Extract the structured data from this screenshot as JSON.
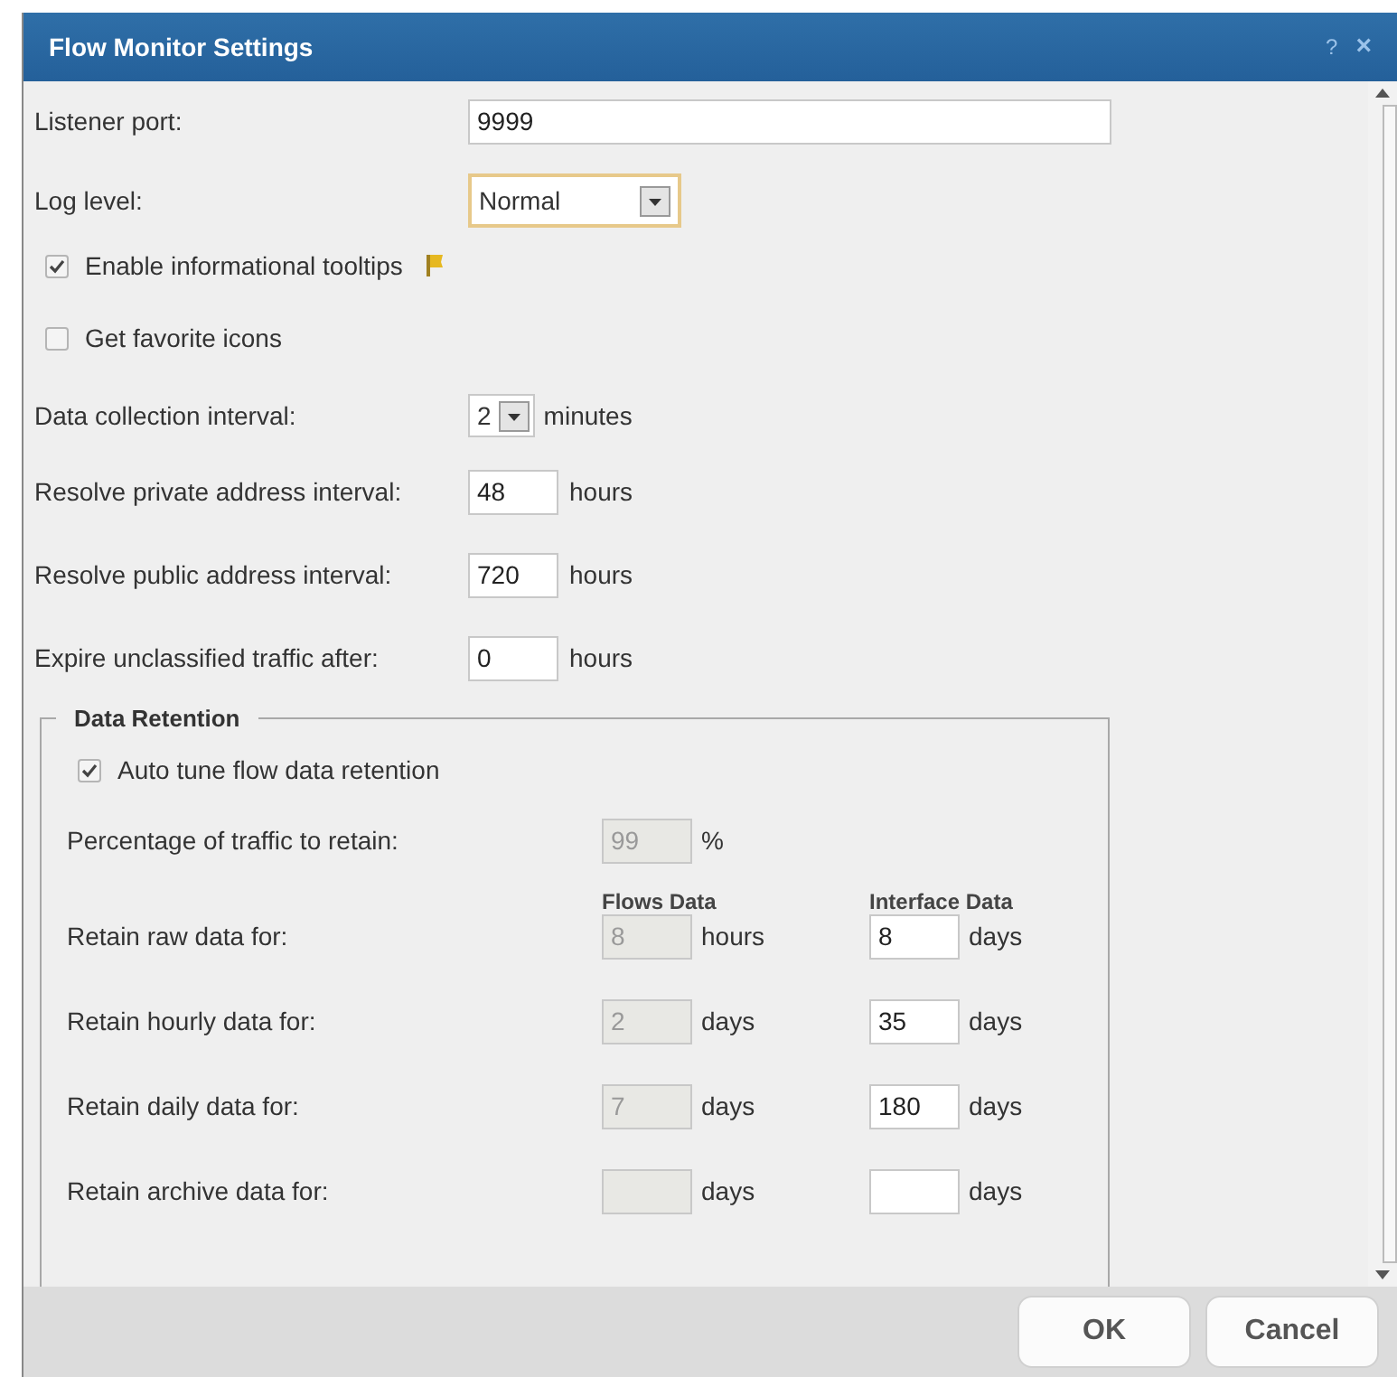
{
  "window": {
    "title": "Flow Monitor Settings",
    "help": "?",
    "close": "×"
  },
  "settings": [
    {
      "kind": "text",
      "label": "Listener port:",
      "value": "9999"
    },
    {
      "kind": "select",
      "label": "Log level:",
      "value": "Normal",
      "focused": true
    },
    {
      "kind": "checkbox",
      "label": "Enable informational tooltips",
      "checked": true,
      "flag": true
    },
    {
      "kind": "checkbox",
      "label": "Get favorite icons",
      "checked": false,
      "flag": false
    },
    {
      "kind": "small-select",
      "label": "Data collection interval:",
      "value": "2",
      "unit": "minutes"
    },
    {
      "kind": "number",
      "label": "Resolve private address interval:",
      "value": "48",
      "unit": "hours"
    },
    {
      "kind": "number",
      "label": "Resolve public address interval:",
      "value": "720",
      "unit": "hours"
    },
    {
      "kind": "number",
      "label": "Expire unclassified traffic after:",
      "value": "0",
      "unit": "hours"
    }
  ],
  "retention": {
    "title": "Data Retention",
    "auto_tune": {
      "label": "Auto tune flow data retention",
      "checked": true
    },
    "percentage": {
      "label": "Percentage of traffic to retain:",
      "value": "99",
      "unit": "%",
      "disabled": true
    },
    "columns": [
      "Flows Data",
      "Interface Data"
    ],
    "rows": [
      {
        "label": "Retain raw data for:",
        "flows": "8",
        "flows_unit": "hours",
        "flows_disabled": true,
        "iface": "8",
        "iface_unit": "days"
      },
      {
        "label": "Retain hourly data for:",
        "flows": "2",
        "flows_unit": "days",
        "flows_disabled": true,
        "iface": "35",
        "iface_unit": "days"
      },
      {
        "label": "Retain daily data for:",
        "flows": "7",
        "flows_unit": "days",
        "flows_disabled": true,
        "iface": "180",
        "iface_unit": "days"
      },
      {
        "label": "Retain archive data for:",
        "flows_unit": "days",
        "flows_disabled": true,
        "iface_unit": "days"
      }
    ]
  },
  "buttons": [
    "OK",
    "Cancel"
  ]
}
